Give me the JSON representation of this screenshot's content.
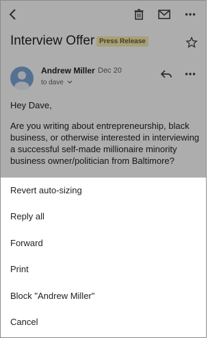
{
  "subject": "Interview Offer",
  "label_badge": "Press Release",
  "sender": {
    "name": "Andrew Miller",
    "date": "Dec 20",
    "recipient": "to dave"
  },
  "body": {
    "greeting": "Hey Dave,",
    "paragraph": "Are you writing about entrepreneurship, black business, or otherwise interested in interviewing a successful self-made millionaire minority business owner/politician from Baltimore?"
  },
  "action_sheet": {
    "items": [
      "Revert auto-sizing",
      "Reply all",
      "Forward",
      "Print",
      "Block \"Andrew Miller\"",
      "Cancel"
    ]
  },
  "icons": {
    "back": "back-arrow-icon",
    "delete": "trash-icon",
    "mail": "mail-icon",
    "more": "more-vertical-icon",
    "star": "star-icon",
    "reply": "reply-icon"
  },
  "colors": {
    "badge_bg": "#f6ecb4",
    "avatar": "#7ea7d8",
    "overlay": "rgba(0,0,0,0.32)"
  }
}
